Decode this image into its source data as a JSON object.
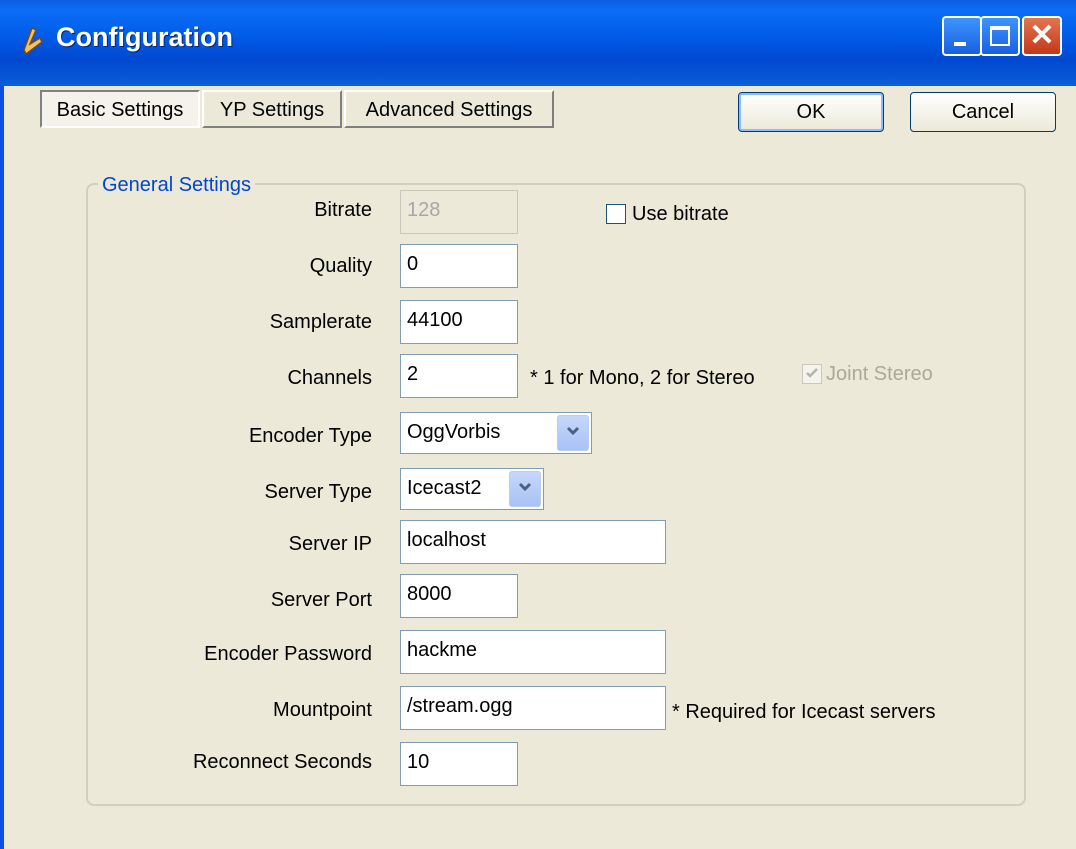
{
  "window": {
    "title": "Configuration"
  },
  "tabs": [
    {
      "label": "Basic Settings",
      "active": true
    },
    {
      "label": "YP Settings",
      "active": false
    },
    {
      "label": "Advanced Settings",
      "active": false
    }
  ],
  "buttons": {
    "ok": "OK",
    "cancel": "Cancel"
  },
  "group": {
    "title": "General Settings"
  },
  "fields": {
    "bitrate": {
      "label": "Bitrate",
      "value": "128",
      "disabled": true
    },
    "quality": {
      "label": "Quality",
      "value": "0"
    },
    "samplerate": {
      "label": "Samplerate",
      "value": "44100"
    },
    "channels": {
      "label": "Channels",
      "value": "2",
      "note": "* 1 for Mono, 2 for Stereo"
    },
    "encoder_type": {
      "label": "Encoder Type",
      "value": "OggVorbis"
    },
    "server_type": {
      "label": "Server Type",
      "value": "Icecast2"
    },
    "server_ip": {
      "label": "Server IP",
      "value": "localhost"
    },
    "server_port": {
      "label": "Server Port",
      "value": "8000"
    },
    "encoder_password": {
      "label": "Encoder Password",
      "value": "hackme"
    },
    "mountpoint": {
      "label": "Mountpoint",
      "value": "/stream.ogg",
      "note": "* Required for Icecast servers"
    },
    "reconnect_seconds": {
      "label": "Reconnect Seconds",
      "value": "10"
    }
  },
  "checkboxes": {
    "use_bitrate": {
      "label": "Use bitrate",
      "checked": false,
      "enabled": true
    },
    "joint_stereo": {
      "label": "Joint Stereo",
      "checked": true,
      "enabled": false
    }
  },
  "colors": {
    "titlebar": "#0058e6",
    "group_title": "#0046d5",
    "dialog_bg": "#ece9d8",
    "close_button": "#d34a26"
  }
}
